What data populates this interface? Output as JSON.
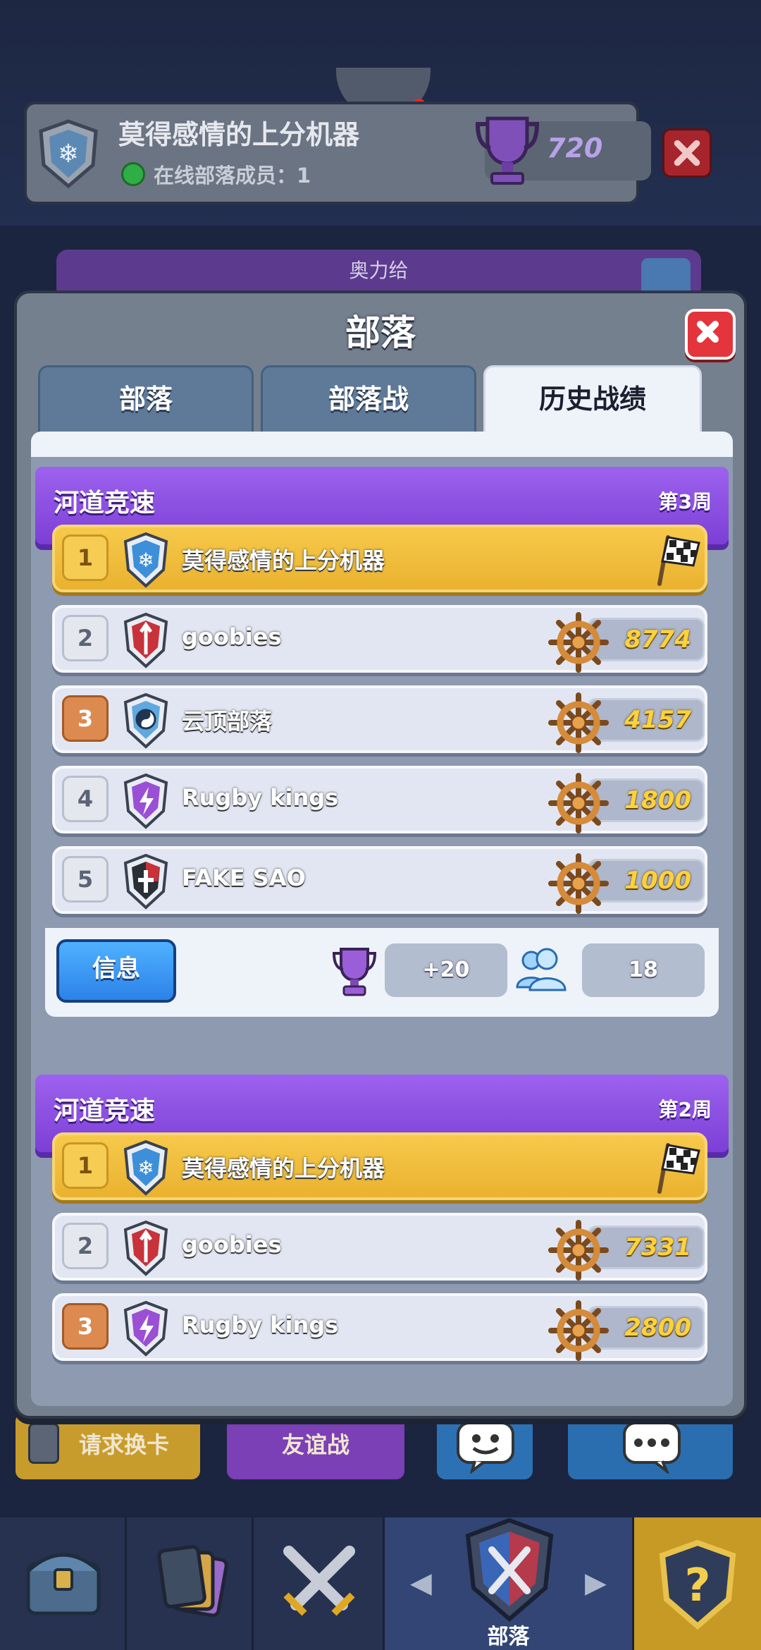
{
  "background": {
    "clan_name": "莫得感情的上分机器",
    "online_text": "在线部落成员：1",
    "trophies": "720",
    "info_bar_text": "奥力给",
    "actions": {
      "request_cards": "请求换卡",
      "friendly_battle": "友谊战"
    },
    "nav": {
      "active_label": "部落"
    }
  },
  "modal": {
    "title": "部落",
    "tabs": [
      {
        "label": "部落",
        "active": false
      },
      {
        "label": "部落战",
        "active": false
      },
      {
        "label": "历史战绩",
        "active": true
      }
    ],
    "wars": [
      {
        "title": "河道竞速",
        "week": "第3周",
        "rows": [
          {
            "rank": "1",
            "name": "莫得感情的上分机器",
            "score": "",
            "finished": true
          },
          {
            "rank": "2",
            "name": "goobies",
            "score": "8774"
          },
          {
            "rank": "3",
            "name": "云顶部落",
            "score": "4157"
          },
          {
            "rank": "4",
            "name": "Rugby kings",
            "score": "1800"
          },
          {
            "rank": "5",
            "name": "FAKE SAO",
            "score": "1000"
          }
        ],
        "footer": {
          "info_label": "信息",
          "trophy_change": "+20",
          "participants": "18"
        }
      },
      {
        "title": "河道竞速",
        "week": "第2周",
        "rows": [
          {
            "rank": "1",
            "name": "莫得感情的上分机器",
            "score": "",
            "finished": true
          },
          {
            "rank": "2",
            "name": "goobies",
            "score": "7331"
          },
          {
            "rank": "3",
            "name": "Rugby kings",
            "score": "2800"
          }
        ]
      }
    ]
  },
  "colors": {
    "ribbon": "#8b4fe6",
    "gold_row": "#f0bd3c",
    "info_button": "#3a98f2",
    "close_button": "#e4343c"
  }
}
